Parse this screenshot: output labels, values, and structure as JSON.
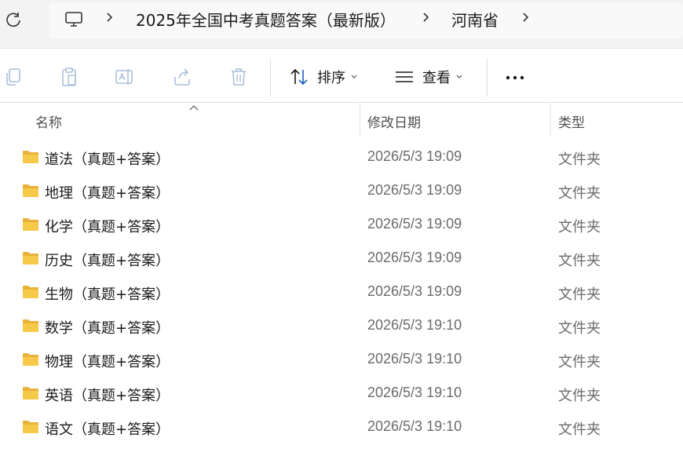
{
  "breadcrumb": {
    "items": [
      "2025年全国中考真题答案（最新版）",
      "河南省"
    ]
  },
  "toolbar": {
    "sort_label": "排序",
    "view_label": "查看"
  },
  "columns": {
    "name": "名称",
    "modified": "修改日期",
    "type": "类型"
  },
  "files": [
    {
      "name": "道法（真题+答案）",
      "modified": "2026/5/3 19:09",
      "type": "文件夹"
    },
    {
      "name": "地理（真题+答案）",
      "modified": "2026/5/3 19:09",
      "type": "文件夹"
    },
    {
      "name": "化学（真题+答案）",
      "modified": "2026/5/3 19:09",
      "type": "文件夹"
    },
    {
      "name": "历史（真题+答案）",
      "modified": "2026/5/3 19:09",
      "type": "文件夹"
    },
    {
      "name": "生物（真题+答案）",
      "modified": "2026/5/3 19:09",
      "type": "文件夹"
    },
    {
      "name": "数学（真题+答案）",
      "modified": "2026/5/3 19:10",
      "type": "文件夹"
    },
    {
      "name": "物理（真题+答案）",
      "modified": "2026/5/3 19:10",
      "type": "文件夹"
    },
    {
      "name": "英语（真题+答案）",
      "modified": "2026/5/3 19:10",
      "type": "文件夹"
    },
    {
      "name": "语文（真题+答案）",
      "modified": "2026/5/3 19:10",
      "type": "文件夹"
    }
  ],
  "colors": {
    "folder": "#f7c948",
    "folder_dark": "#e8b23a",
    "disabled_icon": "#a9bfd9",
    "text_secondary": "#6b6b6b"
  }
}
